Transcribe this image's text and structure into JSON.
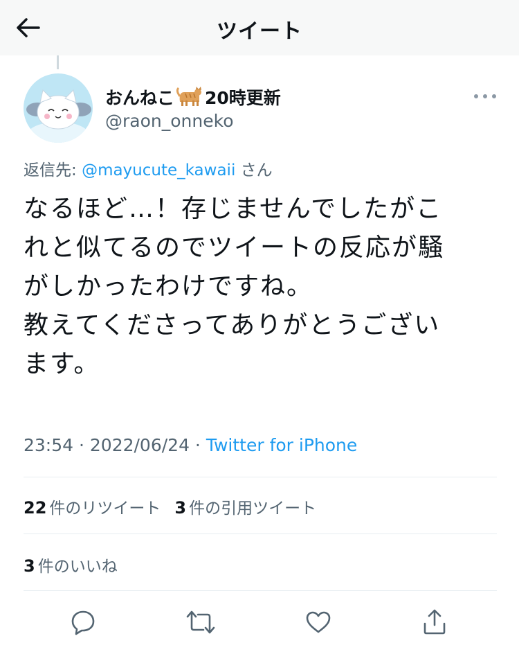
{
  "header": {
    "title": "ツイート"
  },
  "user": {
    "name_prefix": "おんねこ",
    "name_suffix": "20時更新",
    "handle": "@raon_onneko",
    "emoji_icon": "cat-emoji-icon"
  },
  "reply": {
    "label": "返信先:",
    "mention": "@mayucute_kawaii",
    "suffix": "さん"
  },
  "tweet": {
    "text": "なるほど…！存じませんでしたがこ\nれと似てるのでツイートの反応が騒\nがしかったわけですね。\n教えてくださってありがとうござい\nます。"
  },
  "meta": {
    "time": "23:54",
    "sep1": " · ",
    "date": "2022/06/24",
    "sep2": " · ",
    "source": "Twitter for iPhone"
  },
  "stats": {
    "retweets_count": "22",
    "retweets_label": "件のリツイート",
    "quotes_count": "3",
    "quotes_label": "件の引用ツイート",
    "likes_count": "3",
    "likes_label": "件のいいね"
  },
  "colors": {
    "accent": "#1d9bf0",
    "secondary_text": "#536471",
    "primary_text": "#0f1419",
    "divider": "#e6ecf0"
  },
  "icons": [
    "back-arrow-icon",
    "more-icon",
    "reply-icon",
    "retweet-icon",
    "like-icon",
    "share-icon"
  ]
}
